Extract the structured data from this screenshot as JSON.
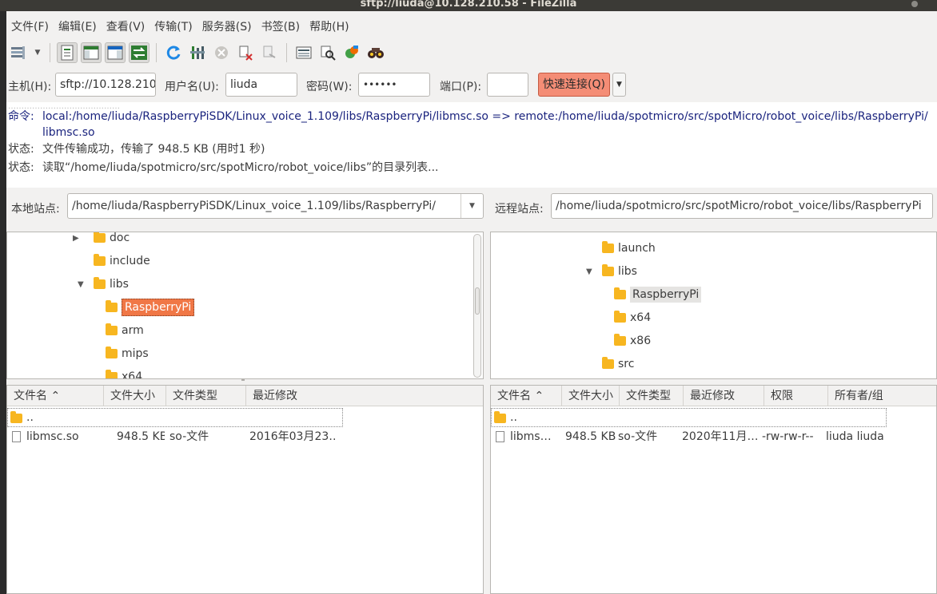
{
  "window": {
    "title": "sftp://liuda@10.128.210.58 - FileZilla"
  },
  "menu": [
    {
      "label": "文件(F)"
    },
    {
      "label": "编辑(E)"
    },
    {
      "label": "查看(V)"
    },
    {
      "label": "传输(T)"
    },
    {
      "label": "服务器(S)"
    },
    {
      "label": "书签(B)"
    },
    {
      "label": "帮助(H)"
    }
  ],
  "toolbar": {
    "icons": [
      "site-manager-icon",
      "toggle-message-log-icon",
      "toggle-local-tree-icon",
      "toggle-remote-tree-icon",
      "toggle-queue-icon",
      "refresh-icon",
      "process-queue-icon",
      "cancel-icon",
      "disconnect-icon",
      "reconnect-icon",
      "filter-icon",
      "compare-icon",
      "sync-browse-icon",
      "search-icon"
    ]
  },
  "quickconnect": {
    "host_label": "主机(H):",
    "host_value": "sftp://10.128.210.",
    "user_label": "用户名(U):",
    "user_value": "liuda",
    "pass_label": "密码(W):",
    "pass_value": "••••••",
    "port_label": "端口(P):",
    "port_value": "",
    "connect_label": "快速连接(Q)",
    "accent": "#f48d76"
  },
  "log": [
    {
      "label": "命令:",
      "text": "local:/home/liuda/RaspberryPiSDK/Linux_voice_1.109/libs/RaspberryPi/libmsc.so => remote:/home/liuda/spotmicro/src/spotMicro/robot_voice/libs/RaspberryPi/"
    },
    {
      "label": "",
      "text": "libmsc.so"
    },
    {
      "label": "状态:",
      "text": "文件传输成功，传输了 948.5 KB (用时1 秒)"
    },
    {
      "label": "状态:",
      "text": "读取“/home/liuda/spotmicro/src/spotMicro/robot_voice/libs”的目录列表..."
    }
  ],
  "local": {
    "site_label": "本地站点:",
    "path": "/home/liuda/RaspberryPiSDK/Linux_voice_1.109/libs/RaspberryPi/",
    "tree": [
      {
        "name": "doc",
        "expander": "▶"
      },
      {
        "name": "include",
        "expander": ""
      },
      {
        "name": "libs",
        "expander": "▼"
      },
      {
        "name": "RaspberryPi",
        "expander": ""
      },
      {
        "name": "arm",
        "expander": ""
      },
      {
        "name": "mips",
        "expander": ""
      },
      {
        "name": "x64",
        "expander": ""
      }
    ],
    "columns": [
      "文件名",
      "文件大小",
      "文件类型",
      "最近修改"
    ],
    "rows": [
      {
        "name": "..",
        "size": "",
        "type": "",
        "modified": ""
      },
      {
        "name": "libmsc.so",
        "size": "948.5 KB",
        "type": "so-文件",
        "modified": "2016年03月23…"
      }
    ]
  },
  "remote": {
    "site_label": "远程站点:",
    "path": "/home/liuda/spotmicro/src/spotMicro/robot_voice/libs/RaspberryPi",
    "tree": [
      {
        "name": "launch",
        "expander": ""
      },
      {
        "name": "libs",
        "expander": "▼"
      },
      {
        "name": "RaspberryPi",
        "expander": ""
      },
      {
        "name": "x64",
        "expander": ""
      },
      {
        "name": "x86",
        "expander": ""
      },
      {
        "name": "src",
        "expander": ""
      }
    ],
    "columns": [
      "文件名",
      "文件大小",
      "文件类型",
      "最近修改",
      "权限",
      "所有者/组"
    ],
    "rows": [
      {
        "name": "..",
        "size": "",
        "type": "",
        "modified": "",
        "perm": "",
        "owner": ""
      },
      {
        "name": "libms…",
        "size": "948.5 KB",
        "type": "so-文件",
        "modified": "2020年11月…",
        "perm": "-rw-rw-r--",
        "owner": "liuda liuda"
      }
    ]
  }
}
